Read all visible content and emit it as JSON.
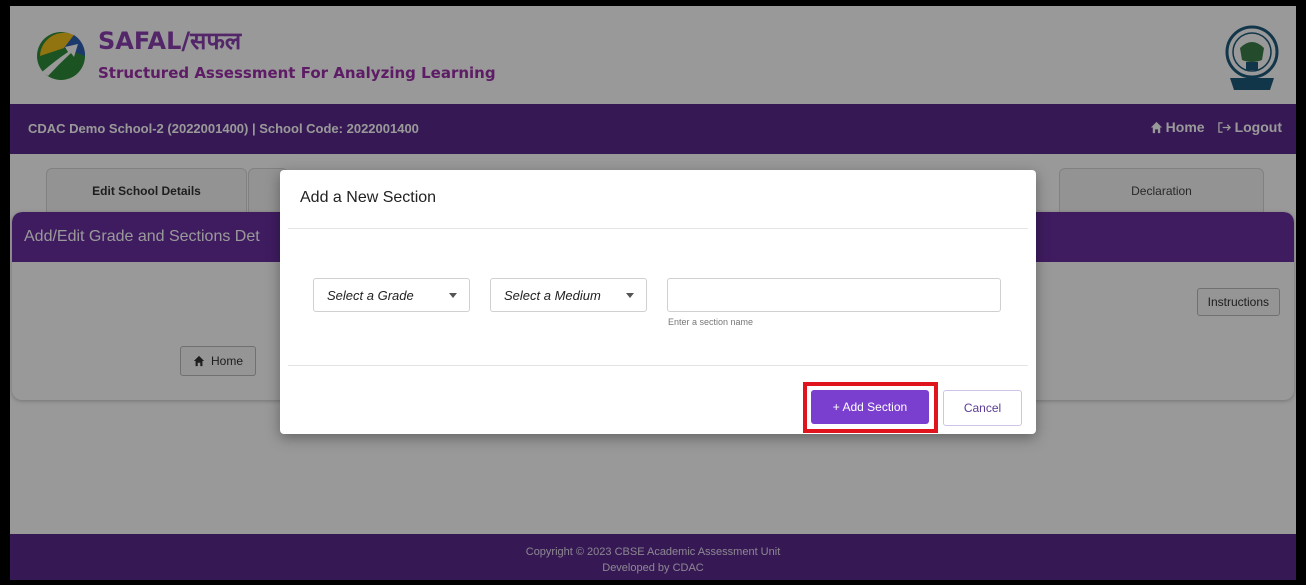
{
  "header": {
    "brand_title": "SAFAL/सफल",
    "brand_subtitle": "Structured Assessment For Analyzing Learning"
  },
  "navbar": {
    "school_info": "CDAC Demo School-2 (2022001400) | School Code: 2022001400",
    "home_label": "Home",
    "logout_label": "Logout"
  },
  "tabs": {
    "edit_school": "Edit School Details",
    "declaration": "Declaration"
  },
  "card": {
    "title": "Add/Edit Grade and Sections Det",
    "instructions_label": "Instructions",
    "home_label": "Home"
  },
  "footer": {
    "copyright": "Copyright © 2023 CBSE Academic Assessment Unit",
    "developer": "Developed by CDAC"
  },
  "modal": {
    "title": "Add a New Section",
    "grade_select": "Select a Grade",
    "medium_select": "Select a Medium",
    "section_input_value": "",
    "section_hint": "Enter a section name",
    "add_button": "+ Add Section",
    "cancel_button": "Cancel"
  },
  "colors": {
    "primary_purple": "#5b2a8c",
    "button_purple": "#7b3fd0",
    "highlight_red": "#e0141c",
    "brand_magenta": "#8b3fb0"
  },
  "icons": {
    "logo": "safal-logo-icon",
    "emblem": "cbse-emblem-icon",
    "home": "home-icon",
    "logout": "logout-icon",
    "caret": "chevron-down-icon"
  }
}
